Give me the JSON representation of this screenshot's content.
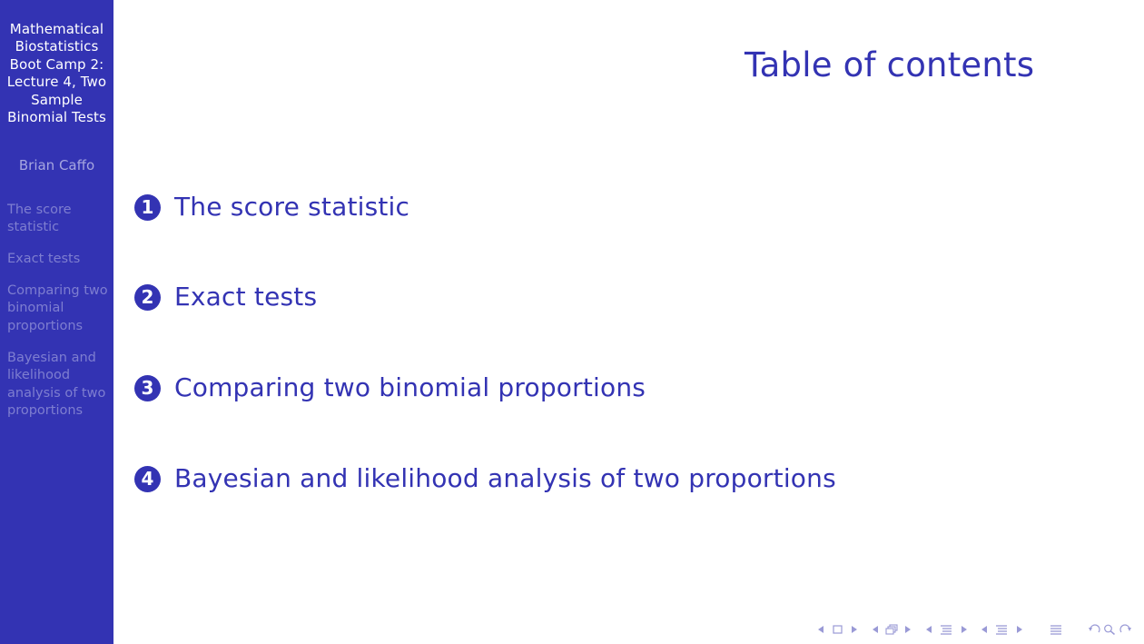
{
  "sidebar": {
    "title": "Mathematical Biostatistics Boot Camp 2: Lecture 4, Two Sample Binomial Tests",
    "author": "Brian Caffo",
    "sections": [
      {
        "label": "The score statistic"
      },
      {
        "label": "Exact tests"
      },
      {
        "label": "Comparing two binomial proportions"
      },
      {
        "label": "Bayesian and likelihood analysis of two proportions"
      }
    ]
  },
  "frame": {
    "title": "Table of contents"
  },
  "toc": [
    {
      "number": "1",
      "label": "The score statistic"
    },
    {
      "number": "2",
      "label": "Exact tests"
    },
    {
      "number": "3",
      "label": "Comparing two binomial proportions"
    },
    {
      "number": "4",
      "label": "Bayesian and likelihood analysis of two proportions"
    }
  ],
  "colors": {
    "sidebar_bg": "#3333b3",
    "accent": "#3333b3",
    "sidebar_text": "#ffffff",
    "sidebar_author": "#a6a6e0",
    "sidebar_nav": "#7e7ed0",
    "nav_symbols": "#9a9ad6"
  },
  "navigation": {
    "icons": [
      "prev-slide-arrow-icon",
      "slide-icon",
      "next-slide-arrow-icon",
      "prev-frame-arrow-icon",
      "frame-icon",
      "next-frame-arrow-icon",
      "prev-subsection-arrow-icon",
      "subsection-icon",
      "next-subsection-arrow-icon",
      "prev-section-arrow-icon",
      "section-icon",
      "next-section-arrow-icon",
      "document-icon",
      "back-icon",
      "search-icon",
      "forward-icon"
    ]
  }
}
